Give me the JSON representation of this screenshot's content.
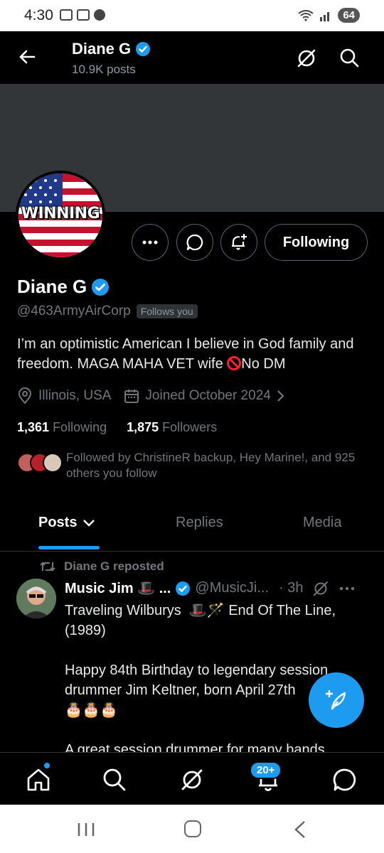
{
  "status_bar": {
    "time": "4:30",
    "battery": "64"
  },
  "header": {
    "name": "Diane G",
    "posts": "10.9K posts"
  },
  "profile": {
    "avatar_text": "WINNING",
    "name": "Diane G",
    "handle": "@463ArmyAirCorp",
    "follows_you": "Follows you",
    "bio_part1": "I’m an optimistic American I believe in God family and freedom. MAGA MAHA VET wife ",
    "bio_part2": "No DM",
    "location": "Illinois, USA",
    "joined": "Joined October 2024",
    "following_count": "1,361",
    "following_label": "Following",
    "followers_count": "1,875",
    "followers_label": "Followers",
    "followed_by": "Followed by ChristineR backup, Hey Marine!, and 925 others you follow",
    "following_button": "Following"
  },
  "tabs": {
    "posts": "Posts",
    "replies": "Replies",
    "media": "Media"
  },
  "post": {
    "repost_label": "Diane G reposted",
    "author": "Music Jim 🎩 ...",
    "handle": "@MusicJi...",
    "time": "· 3h",
    "text": "Traveling Wilburys  🎩🪄 End Of The Line, (1989)\n\nHappy 84th Birthday to legendary session drummer Jim Keltner, born April 27th\n🎂🎂🎂\n\nA great session drummer for many bands"
  },
  "bottom_nav": {
    "notif_badge": "20+"
  },
  "colors": {
    "accent": "#1d9bf0",
    "background": "#000000",
    "muted": "#71767b",
    "banner": "#333639"
  }
}
